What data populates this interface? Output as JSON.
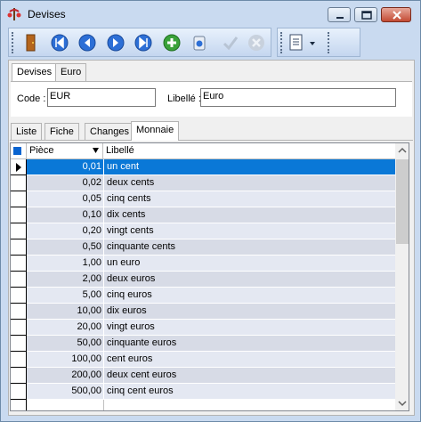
{
  "window": {
    "title": "Devises"
  },
  "outer_tabs": [
    "Devises",
    "Euro"
  ],
  "form": {
    "code_label": "Code :",
    "code_value": "EUR",
    "libelle_label": "Libellé :",
    "libelle_value": "Euro"
  },
  "inner_tabs": [
    "Liste",
    "Fiche",
    "Changes",
    "Monnaie"
  ],
  "active_inner_tab": "Monnaie",
  "grid": {
    "columns": [
      "Pièce",
      "Libellé"
    ],
    "rows": [
      {
        "piece": "0,01",
        "libelle": "un  cent"
      },
      {
        "piece": "0,02",
        "libelle": "deux  cents"
      },
      {
        "piece": "0,05",
        "libelle": "cinq  cents"
      },
      {
        "piece": "0,10",
        "libelle": "dix  cents"
      },
      {
        "piece": "0,20",
        "libelle": "vingt  cents"
      },
      {
        "piece": "0,50",
        "libelle": "cinquante  cents"
      },
      {
        "piece": "1,00",
        "libelle": "un euro"
      },
      {
        "piece": "2,00",
        "libelle": "deux euros"
      },
      {
        "piece": "5,00",
        "libelle": "cinq euros"
      },
      {
        "piece": "10,00",
        "libelle": "dix euros"
      },
      {
        "piece": "20,00",
        "libelle": "vingt euros"
      },
      {
        "piece": "50,00",
        "libelle": "cinquante euros"
      },
      {
        "piece": "100,00",
        "libelle": "cent euros"
      },
      {
        "piece": "200,00",
        "libelle": "deux cent euros"
      },
      {
        "piece": "500,00",
        "libelle": "cinq cent euros"
      }
    ],
    "selected_row": 0
  },
  "toolbar": {
    "icons": [
      "exit-door-icon",
      "first-record-icon",
      "previous-record-icon",
      "next-record-icon",
      "last-record-icon",
      "add-record-icon",
      "delete-record-icon",
      "validate-icon",
      "cancel-icon",
      "report-menu-icon"
    ]
  },
  "colors": {
    "selection": "#0a78d7",
    "frame": "#c9daf0",
    "row_odd": "#e4e8f2",
    "row_even": "#d7dbe6"
  }
}
